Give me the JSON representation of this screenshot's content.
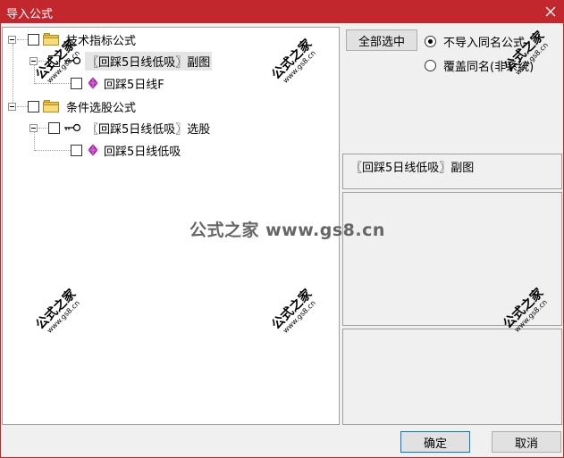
{
  "window": {
    "title": "导入公式"
  },
  "tree": {
    "nodes": [
      {
        "label": "技术指标公式",
        "icon": "folder-icon"
      },
      {
        "label": "〖回踩5日线低吸〗副图",
        "icon": "key-icon"
      },
      {
        "label": "回踩5日线F",
        "icon": "gem-icon"
      },
      {
        "label": "条件选股公式",
        "icon": "folder-icon"
      },
      {
        "label": "〖回踩5日线低吸〗选股",
        "icon": "key-icon"
      },
      {
        "label": "回踩5日线低吸",
        "icon": "gem-icon"
      }
    ]
  },
  "right": {
    "select_all": "全部选中",
    "radio_no_import": "不导入同名公式",
    "radio_overwrite": "覆盖同名(非系统)",
    "preview_title": "〖回踩5日线低吸〗副图"
  },
  "buttons": {
    "ok": "确定",
    "cancel": "取消"
  },
  "watermark": {
    "brand": "公式之家",
    "site": "www.gs8.cn",
    "center": "公式之家 www.gs8.cn"
  },
  "colors": {
    "titlebar": "#c1272d",
    "gem": "#c030c0",
    "folder": "#e8c250"
  }
}
